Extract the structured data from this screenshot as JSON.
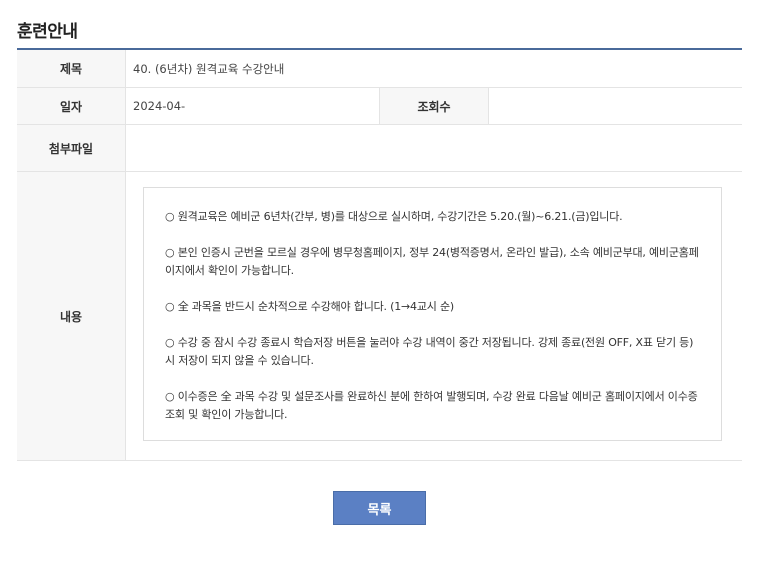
{
  "page": {
    "title": "훈련안내"
  },
  "detail": {
    "subject_label": "제목",
    "subject_value": "40. (6년차) 원격교육 수강안내",
    "date_label": "일자",
    "date_value": "2024-04-",
    "views_label": "조회수",
    "views_value": "",
    "attachment_label": "첨부파일",
    "attachment_value": "",
    "content_label": "내용",
    "content_paragraphs": [
      "○ 원격교육은 예비군 6년차(간부, 병)를 대상으로 실시하며, 수강기간은 5.20.(월)~6.21.(금)입니다.",
      "○ 본인 인증시 군번을 모르실 경우에 병무청홈페이지, 정부 24(병적증명서, 온라인 발급), 소속 예비군부대, 예비군홈페이지에서 확인이 가능합니다.",
      "○ 全 과목을 반드시 순차적으로 수강해야 합니다. (1→4교시 순)",
      "○ 수강 중 잠시 수강 종료시 학습저장 버튼을 눌러야 수강 내역이 중간 저장됩니다. 강제 종료(전원 OFF, X표 닫기 등)시 저장이 되지 않을 수 있습니다.",
      "○ 이수증은 全 과목 수강 및 설문조사를 완료하신 분에 한하여 발행되며, 수강 완료 다음날 예비군 홈페이지에서 이수증 조회 및 확인이 가능합니다."
    ]
  },
  "actions": {
    "list_button_label": "목록"
  },
  "colors": {
    "accent_rule": "#4a6a9a",
    "button_bg": "#5b80c4",
    "header_cell_bg": "#f7f7f7"
  }
}
